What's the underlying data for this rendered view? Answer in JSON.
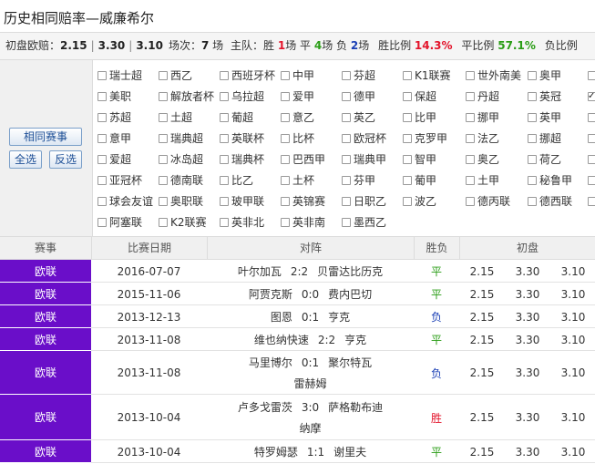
{
  "title": "历史相同赔率—威廉希尔",
  "stats": {
    "init_label": "初盘欧赔：",
    "odds": [
      "2.15",
      "3.30",
      "3.10"
    ],
    "matches_label": "场次：",
    "matches": "7",
    "matches_unit": "场",
    "home_label": "主队：",
    "win_label": "胜",
    "win_count": "1",
    "win_unit": "场 平",
    "draw_count": "4",
    "draw_unit": "场 负",
    "loss_count": "2",
    "loss_unit": "场",
    "win_ratio_label": "胜比例",
    "win_ratio": "14.3%",
    "draw_ratio_label": "平比例",
    "draw_ratio": "57.1%",
    "loss_ratio_label": "负比例"
  },
  "filter": {
    "same_button": "相同赛事",
    "select_all": "全选",
    "invert": "反选",
    "rows": [
      [
        {
          "label": "瑞士超",
          "checked": false
        },
        {
          "label": "西乙",
          "checked": false
        },
        {
          "label": "西班牙杯",
          "checked": false
        },
        {
          "label": "中甲",
          "checked": false
        },
        {
          "label": "芬超",
          "checked": false
        },
        {
          "label": "K1联赛",
          "checked": false
        },
        {
          "label": "世外南美",
          "checked": false
        },
        {
          "label": "奥甲",
          "checked": false
        },
        {
          "label": "",
          "checked": false
        }
      ],
      [
        {
          "label": "美职",
          "checked": false
        },
        {
          "label": "解放者杯",
          "checked": false
        },
        {
          "label": "乌拉超",
          "checked": false
        },
        {
          "label": "爱甲",
          "checked": false
        },
        {
          "label": "德甲",
          "checked": false
        },
        {
          "label": "保超",
          "checked": false
        },
        {
          "label": "丹超",
          "checked": false
        },
        {
          "label": "英冠",
          "checked": false
        },
        {
          "label": "",
          "checked": true
        }
      ],
      [
        {
          "label": "苏超",
          "checked": false
        },
        {
          "label": "土超",
          "checked": false
        },
        {
          "label": "葡超",
          "checked": false
        },
        {
          "label": "意乙",
          "checked": false
        },
        {
          "label": "英乙",
          "checked": false
        },
        {
          "label": "比甲",
          "checked": false
        },
        {
          "label": "挪甲",
          "checked": false
        },
        {
          "label": "英甲",
          "checked": false
        },
        {
          "label": "",
          "checked": false
        }
      ],
      [
        {
          "label": "意甲",
          "checked": false
        },
        {
          "label": "瑞典超",
          "checked": false
        },
        {
          "label": "英联杯",
          "checked": false
        },
        {
          "label": "比杯",
          "checked": false
        },
        {
          "label": "欧冠杯",
          "checked": false
        },
        {
          "label": "克罗甲",
          "checked": false
        },
        {
          "label": "法乙",
          "checked": false
        },
        {
          "label": "挪超",
          "checked": false
        },
        {
          "label": "",
          "checked": false
        }
      ],
      [
        {
          "label": "爱超",
          "checked": false
        },
        {
          "label": "冰岛超",
          "checked": false
        },
        {
          "label": "瑞典杯",
          "checked": false
        },
        {
          "label": "巴西甲",
          "checked": false
        },
        {
          "label": "瑞典甲",
          "checked": false
        },
        {
          "label": "智甲",
          "checked": false
        },
        {
          "label": "奥乙",
          "checked": false
        },
        {
          "label": "荷乙",
          "checked": false
        },
        {
          "label": "",
          "checked": false
        }
      ],
      [
        {
          "label": "亚冠杯",
          "checked": false
        },
        {
          "label": "德南联",
          "checked": false
        },
        {
          "label": "比乙",
          "checked": false
        },
        {
          "label": "土杯",
          "checked": false
        },
        {
          "label": "芬甲",
          "checked": false
        },
        {
          "label": "葡甲",
          "checked": false
        },
        {
          "label": "土甲",
          "checked": false
        },
        {
          "label": "秘鲁甲",
          "checked": false
        },
        {
          "label": "",
          "checked": false
        }
      ],
      [
        {
          "label": "球会友谊",
          "checked": false
        },
        {
          "label": "奥职联",
          "checked": false
        },
        {
          "label": "玻甲联",
          "checked": false
        },
        {
          "label": "英锦赛",
          "checked": false
        },
        {
          "label": "日职乙",
          "checked": false
        },
        {
          "label": "波乙",
          "checked": false
        },
        {
          "label": "德丙联",
          "checked": false
        },
        {
          "label": "德西联",
          "checked": false
        },
        {
          "label": "",
          "checked": false
        }
      ],
      [
        {
          "label": "阿塞联",
          "checked": false
        },
        {
          "label": "K2联赛",
          "checked": false
        },
        {
          "label": "英非北",
          "checked": false
        },
        {
          "label": "英非南",
          "checked": false
        },
        {
          "label": "墨西乙",
          "checked": false
        }
      ]
    ]
  },
  "table": {
    "headers": [
      "赛事",
      "比赛日期",
      "对阵",
      "胜负",
      "初盘"
    ],
    "rows": [
      {
        "league": "欧联",
        "date": "2016-07-07",
        "home": "叶尔加瓦",
        "score": "2:2",
        "away": "贝雷达比历克",
        "home2": "",
        "away2": "",
        "result": "平",
        "odds": [
          "2.15",
          "3.30",
          "3.10"
        ]
      },
      {
        "league": "欧联",
        "date": "2015-11-06",
        "home": "阿贾克斯",
        "score": "0:0",
        "away": "费内巴切",
        "home2": "",
        "away2": "",
        "result": "平",
        "odds": [
          "2.15",
          "3.30",
          "3.10"
        ]
      },
      {
        "league": "欧联",
        "date": "2013-12-13",
        "home": "图恩",
        "score": "0:1",
        "away": "亨克",
        "home2": "",
        "away2": "",
        "result": "负",
        "odds": [
          "2.15",
          "3.30",
          "3.10"
        ]
      },
      {
        "league": "欧联",
        "date": "2013-11-08",
        "home": "维也纳快速",
        "score": "2:2",
        "away": "亨克",
        "home2": "",
        "away2": "",
        "result": "平",
        "odds": [
          "2.15",
          "3.30",
          "3.10"
        ]
      },
      {
        "league": "欧联",
        "date": "2013-11-08",
        "home": "马里博尔",
        "score": "0:1",
        "away": "聚尔特瓦",
        "home2": "",
        "away2": "雷赫姆",
        "result": "负",
        "odds": [
          "2.15",
          "3.30",
          "3.10"
        ]
      },
      {
        "league": "欧联",
        "date": "2013-10-04",
        "home": "卢多戈雷茨",
        "score": "3:0",
        "away": "萨格勒布迪",
        "home2": "",
        "away2": "纳摩",
        "result": "胜",
        "odds": [
          "2.15",
          "3.30",
          "3.10"
        ]
      },
      {
        "league": "欧联",
        "date": "2013-10-04",
        "home": "特罗姆瑟",
        "score": "1:1",
        "away": "谢里夫",
        "home2": "",
        "away2": "",
        "result": "平",
        "odds": [
          "2.15",
          "3.30",
          "3.10"
        ]
      }
    ]
  },
  "colors": {
    "league_bg": "#6a0ec9",
    "win": "#e3142b",
    "draw": "#2a9d16",
    "loss": "#1a3fb5"
  }
}
